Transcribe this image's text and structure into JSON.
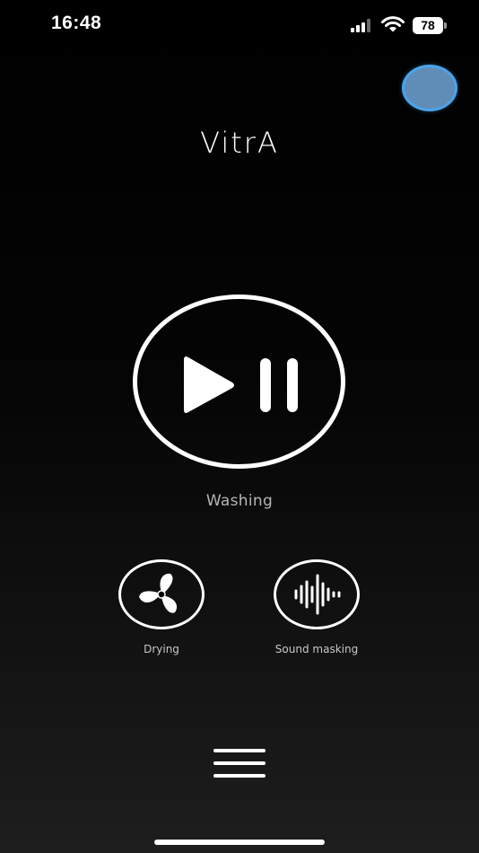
{
  "status_bar": {
    "time": "16:48",
    "battery": "78",
    "signal_icon": "cellular-signal-icon",
    "wifi_icon": "wifi-icon"
  },
  "app": {
    "logo": "VitrA"
  },
  "main_control": {
    "label": "Washing",
    "icon": "play-pause-icon"
  },
  "controls": [
    {
      "label": "Drying",
      "icon": "fan-icon"
    },
    {
      "label": "Sound masking",
      "icon": "sound-wave-icon"
    }
  ],
  "menu": {
    "icon": "hamburger-menu-icon"
  },
  "colors": {
    "background": "#000000",
    "foreground": "#ffffff",
    "label_gray": "#b5b5b5",
    "touch_indicator": "#4aa3ea"
  }
}
